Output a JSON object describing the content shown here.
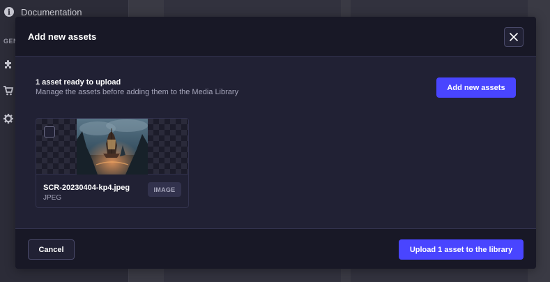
{
  "background": {
    "sidebar": {
      "documentation_label": "Documentation",
      "section_label": "GEN",
      "icons": [
        "info-icon",
        "puzzle-icon",
        "cart-icon",
        "gear-icon"
      ]
    }
  },
  "modal": {
    "title": "Add new assets",
    "close_icon": "close-icon",
    "summary": {
      "title": "1 asset ready to upload",
      "subtitle": "Manage the assets before adding them to the Media Library"
    },
    "add_button_label": "Add new assets",
    "assets": [
      {
        "file_name": "SCR-20230404-kp4.jpeg",
        "extension": "JPEG",
        "type_badge": "IMAGE",
        "selected": false
      }
    ],
    "footer": {
      "cancel_label": "Cancel",
      "upload_label": "Upload 1 asset to the library"
    }
  },
  "colors": {
    "primary": "#4945ff",
    "modal_bg": "#212134",
    "header_bg": "#181826",
    "border": "#32324d",
    "muted_text": "#a5a5ba"
  }
}
